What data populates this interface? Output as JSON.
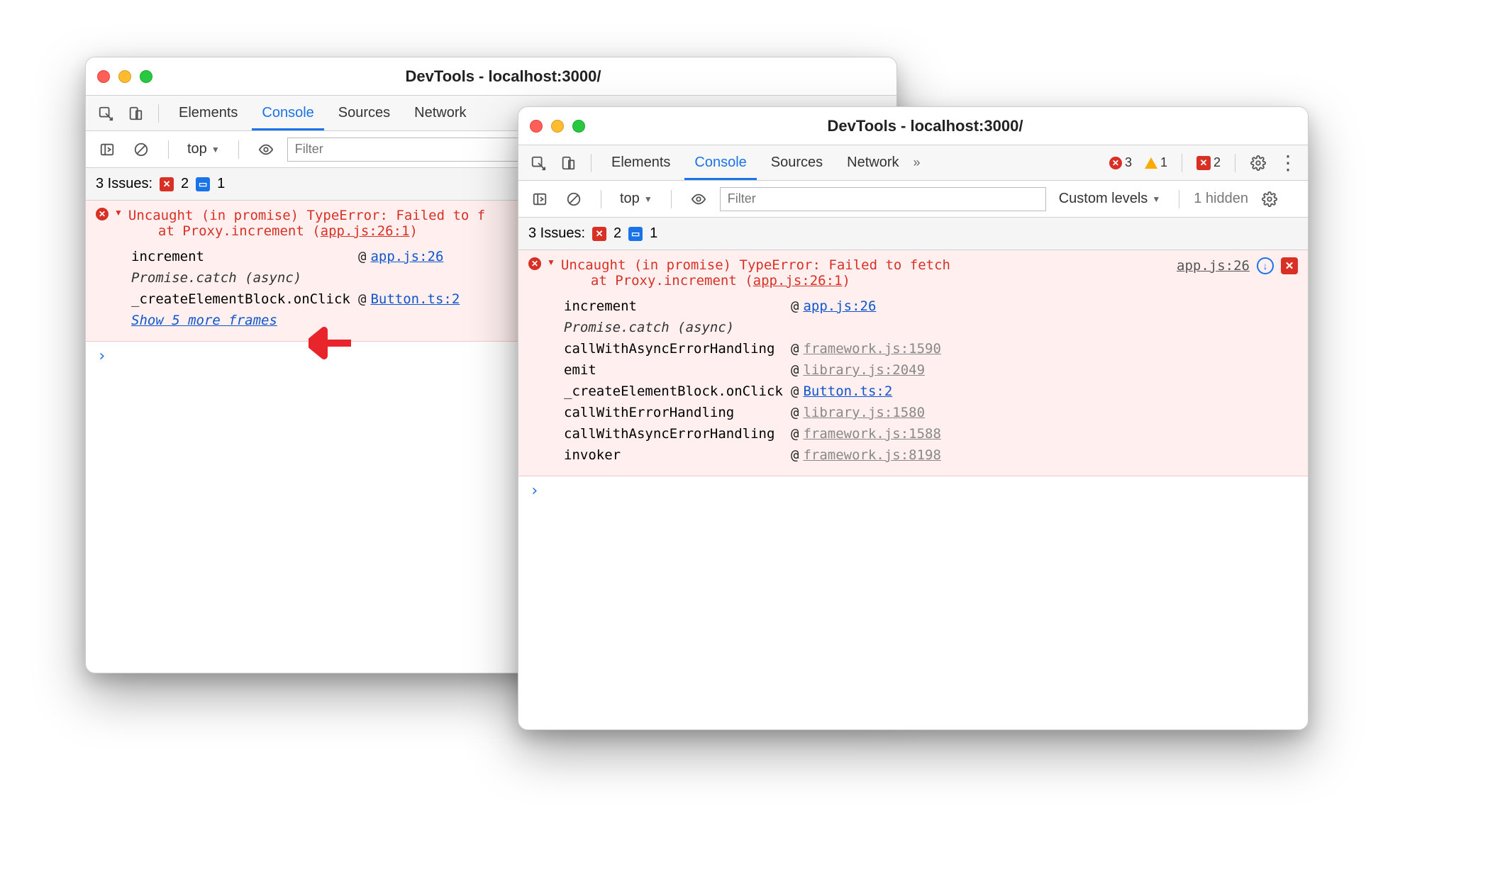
{
  "window1": {
    "title": "DevTools - localhost:3000/",
    "tabs": [
      "Elements",
      "Console",
      "Sources",
      "Network"
    ],
    "activeTab": "Console",
    "context": "top",
    "filterPlaceholder": "Filter",
    "issues": {
      "label": "3 Issues:",
      "err": "2",
      "msg": "1"
    },
    "error": {
      "head": "Uncaught (in promise) TypeError: Failed to f",
      "sub_prefix": "at Proxy.increment (",
      "sub_link": "app.js:26:1",
      "sub_suffix": ")",
      "frames": [
        {
          "fn": "increment",
          "at": "@",
          "src": "app.js:26",
          "grey": false
        },
        {
          "fn": "Promise.catch (async)",
          "ital": true
        },
        {
          "fn": "_createElementBlock.onClick",
          "at": "@",
          "src": "Button.ts:2",
          "grey": false
        }
      ],
      "showMore": "Show 5 more frames"
    }
  },
  "window2": {
    "title": "DevTools - localhost:3000/",
    "tabs": [
      "Elements",
      "Console",
      "Sources",
      "Network"
    ],
    "activeTab": "Console",
    "overflow": "»",
    "context": "top",
    "filterPlaceholder": "Filter",
    "levels": "Custom levels",
    "hidden": "1 hidden",
    "topBadges": {
      "err": "3",
      "warn": "1",
      "msg": "2"
    },
    "issues": {
      "label": "3 Issues:",
      "err": "2",
      "msg": "1"
    },
    "error": {
      "head": "Uncaught (in promise) TypeError: Failed to fetch",
      "sub_prefix": "at Proxy.increment (",
      "sub_link": "app.js:26:1",
      "sub_suffix": ")",
      "sourceRight": "app.js:26",
      "frames": [
        {
          "fn": "increment",
          "at": "@",
          "src": "app.js:26",
          "grey": false
        },
        {
          "fn": "Promise.catch (async)",
          "ital": true
        },
        {
          "fn": "callWithAsyncErrorHandling",
          "at": "@",
          "src": "framework.js:1590",
          "grey": true
        },
        {
          "fn": "emit",
          "at": "@",
          "src": "library.js:2049",
          "grey": true
        },
        {
          "fn": "_createElementBlock.onClick",
          "at": "@",
          "src": "Button.ts:2",
          "grey": false
        },
        {
          "fn": "callWithErrorHandling",
          "at": "@",
          "src": "library.js:1580",
          "grey": true
        },
        {
          "fn": "callWithAsyncErrorHandling",
          "at": "@",
          "src": "framework.js:1588",
          "grey": true
        },
        {
          "fn": "invoker",
          "at": "@",
          "src": "framework.js:8198",
          "grey": true
        }
      ]
    }
  }
}
